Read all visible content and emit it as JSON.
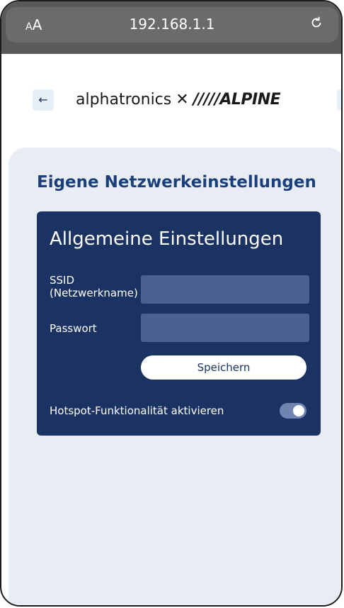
{
  "browser": {
    "aa_label_small": "A",
    "aa_label_large": "A",
    "url": "192.168.1.1"
  },
  "header": {
    "back_label": "←",
    "brand_alphatronics": "alphatronics",
    "brand_x": "✕",
    "brand_alpine": "/////ALPINE"
  },
  "page": {
    "title": "Eigene Netzwerkeinstellungen"
  },
  "settings": {
    "card_title": "Allgemeine Einstellungen",
    "ssid_label": "SSID (Netzwerkname)",
    "ssid_value": "",
    "password_label": "Passwort",
    "password_value": "",
    "save_label": "Speichern",
    "hotspot_label": "Hotspot-Funktionalität aktivieren",
    "hotspot_enabled": true
  },
  "colors": {
    "card_bg": "#1b3363",
    "title_color": "#1b3f7a",
    "content_bg": "#e8edf4"
  }
}
